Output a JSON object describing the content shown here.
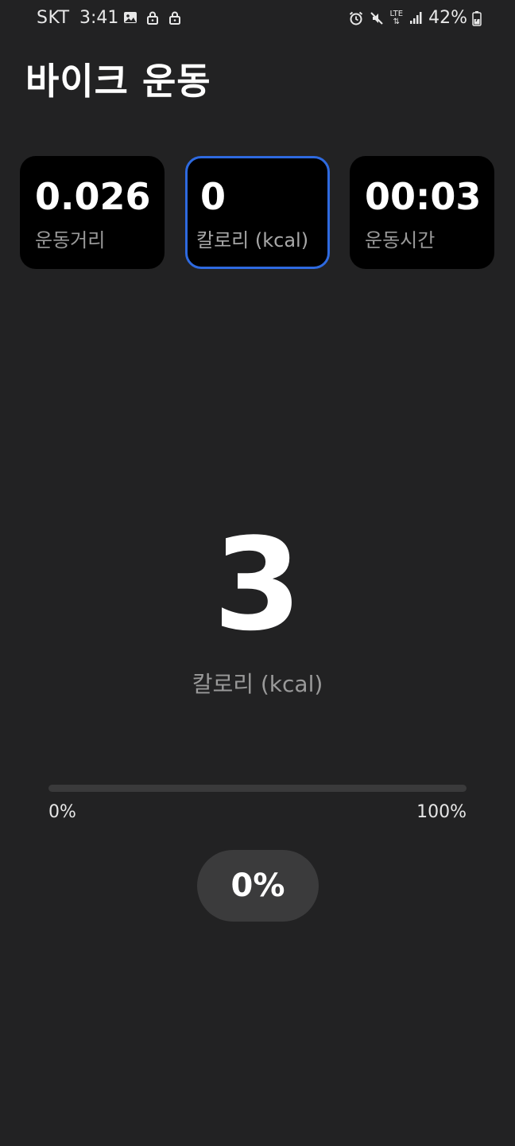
{
  "status_bar": {
    "carrier": "SKT",
    "time": "3:41",
    "network": "LTE",
    "battery": "42%",
    "icons_left": [
      "image-icon",
      "lock-icon",
      "lock-icon"
    ],
    "icons_right": [
      "alarm-icon",
      "mute-icon",
      "lte-icon",
      "signal-icon",
      "battery-charging-icon"
    ]
  },
  "page": {
    "title": "바이크 운동"
  },
  "cards": [
    {
      "value": "0.026",
      "label": "운동거리",
      "selected": false
    },
    {
      "value": "0",
      "label": "칼로리 (kcal)",
      "selected": true
    },
    {
      "value": "00:03",
      "label": "운동시간",
      "selected": false
    }
  ],
  "main_metric": {
    "value": "3",
    "label": "칼로리 (kcal)"
  },
  "progress": {
    "value_percent": 0,
    "min_label": "0%",
    "max_label": "100%",
    "pill_label": "0%"
  },
  "colors": {
    "background": "#222223",
    "card": "#000000",
    "accent": "#2e6ae0",
    "muted_text": "#9a9a9a"
  }
}
